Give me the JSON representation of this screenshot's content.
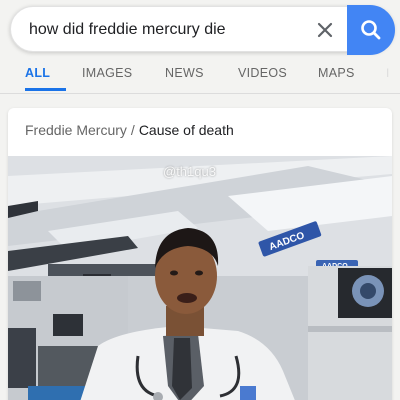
{
  "search": {
    "query": "how did freddie mercury die"
  },
  "tabs": [
    {
      "label": "ALL",
      "active": true
    },
    {
      "label": "IMAGES",
      "active": false
    },
    {
      "label": "NEWS",
      "active": false
    },
    {
      "label": "VIDEOS",
      "active": false
    },
    {
      "label": "MAPS",
      "active": false
    }
  ],
  "result": {
    "entity": "Freddie Mercury",
    "separator": "/",
    "attribute": "Cause of death"
  },
  "video": {
    "watermark": "@th1qu3",
    "sign": "AADCO",
    "sign2": "AADCO"
  },
  "colors": {
    "accent": "#1a73e8",
    "search_button": "#4285f4"
  }
}
